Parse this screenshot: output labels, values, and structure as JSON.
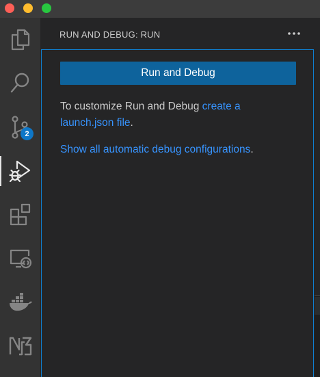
{
  "window": {
    "traffic_lights": {
      "close": "#fe5f57",
      "minimize": "#febc2e",
      "maximize": "#28c840"
    }
  },
  "activity_bar": {
    "items": [
      {
        "icon": "files-icon"
      },
      {
        "icon": "search-icon"
      },
      {
        "icon": "source-control-icon",
        "badge": "2"
      },
      {
        "icon": "run-and-debug-icon",
        "active": true
      },
      {
        "icon": "extensions-icon"
      },
      {
        "icon": "remote-explorer-icon"
      },
      {
        "icon": "docker-icon"
      },
      {
        "icon": "n2-icon"
      }
    ]
  },
  "sidebar": {
    "title": "RUN AND DEBUG: RUN",
    "more_icon": "ellipsis-icon",
    "run_button_label": "Run and Debug",
    "customize_prefix": "To customize Run and Debug ",
    "customize_link": "create a launch.json file",
    "customize_suffix": ".",
    "show_link": "Show all automatic debug configurations",
    "show_suffix": "."
  },
  "colors": {
    "accent": "#0e639c",
    "link": "#3794ff",
    "focus_border": "#0f7fd0",
    "badge": "#0e77c8"
  }
}
